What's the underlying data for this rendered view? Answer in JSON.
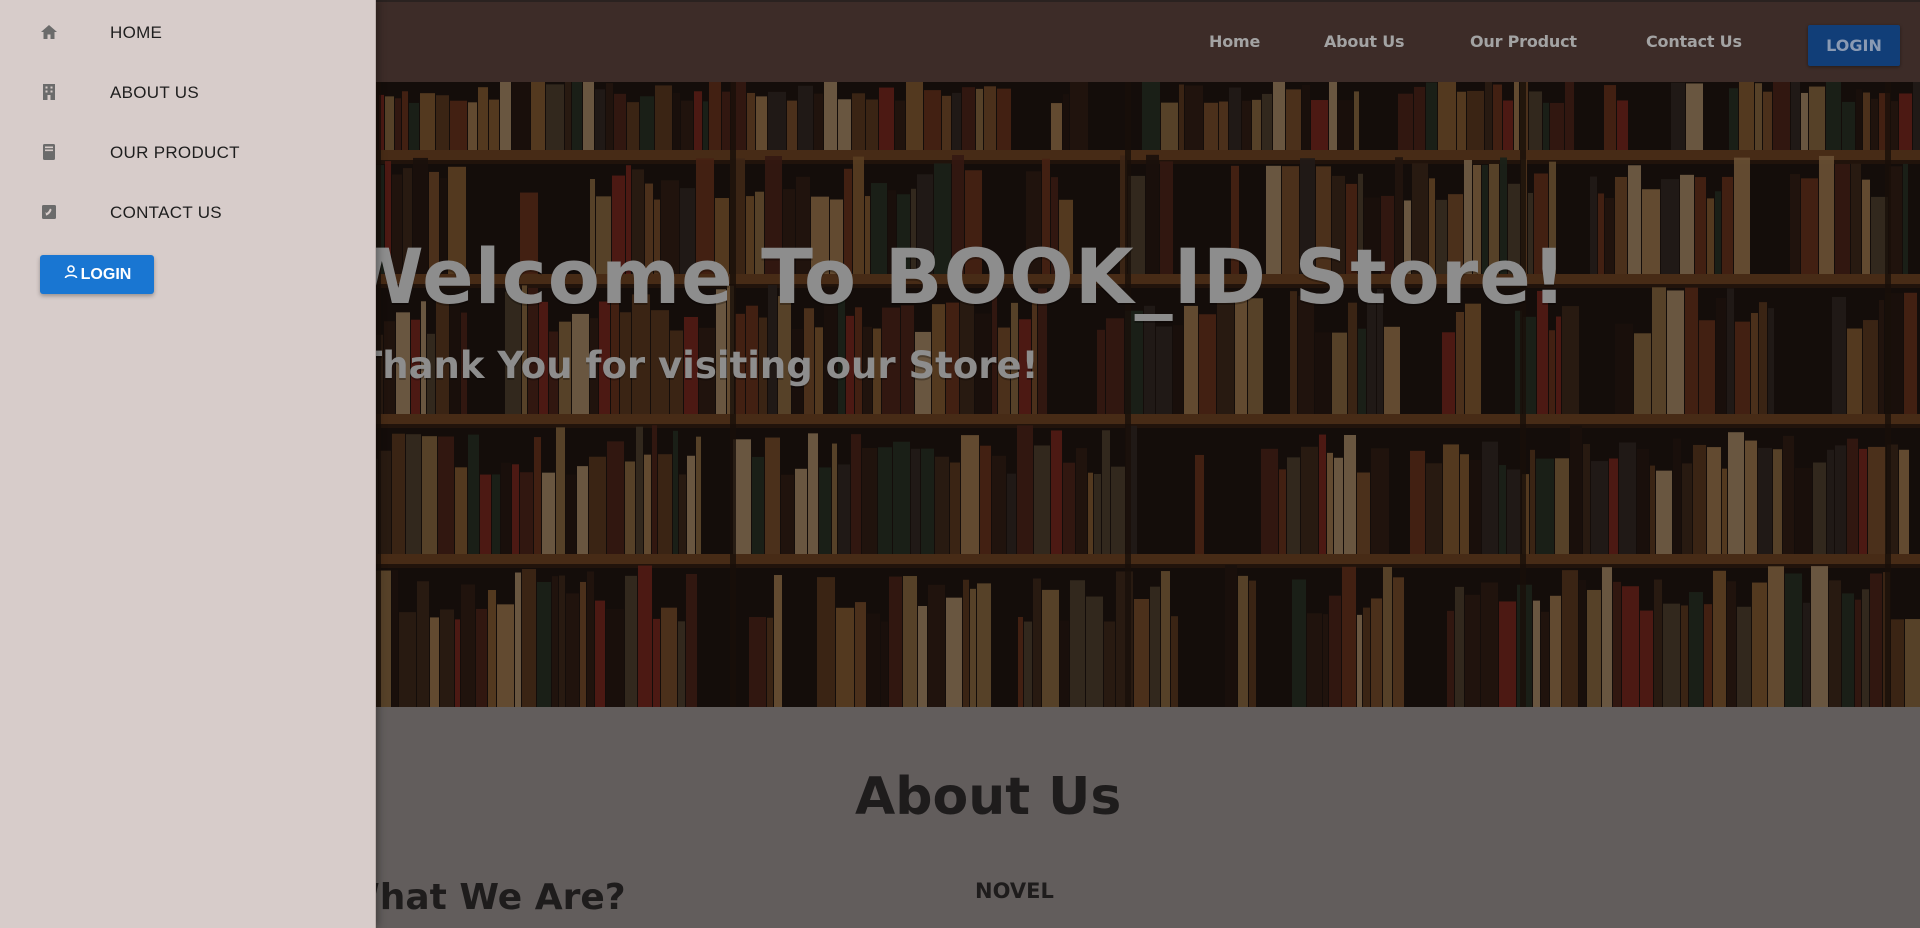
{
  "navbar": {
    "links": [
      {
        "label": "Home"
      },
      {
        "label": "About Us"
      },
      {
        "label": "Our Product"
      },
      {
        "label": "Contact Us"
      }
    ],
    "login_label": "LOGIN"
  },
  "hero": {
    "title": "Welcome To BOOK_ID Store!",
    "subtitle": "Thank You for visiting our Store!",
    "background_icon": "bookshelf-photo"
  },
  "about": {
    "heading": "About Us",
    "who_heading": "What We Are?",
    "novel_label": "NOVEL"
  },
  "drawer": {
    "items": [
      {
        "label": "HOME",
        "icon": "home-icon"
      },
      {
        "label": "ABOUT US",
        "icon": "building-icon"
      },
      {
        "label": "OUR PRODUCT",
        "icon": "book-icon"
      },
      {
        "label": "CONTACT US",
        "icon": "contact-phone-icon"
      }
    ],
    "login_label": "LOGIN",
    "login_icon": "person-icon"
  },
  "colors": {
    "navbar_bg": "#3d2c28",
    "drawer_bg": "#d7ccca",
    "login_blue": "#1976d2",
    "overlay_gray": "#625d5c"
  }
}
